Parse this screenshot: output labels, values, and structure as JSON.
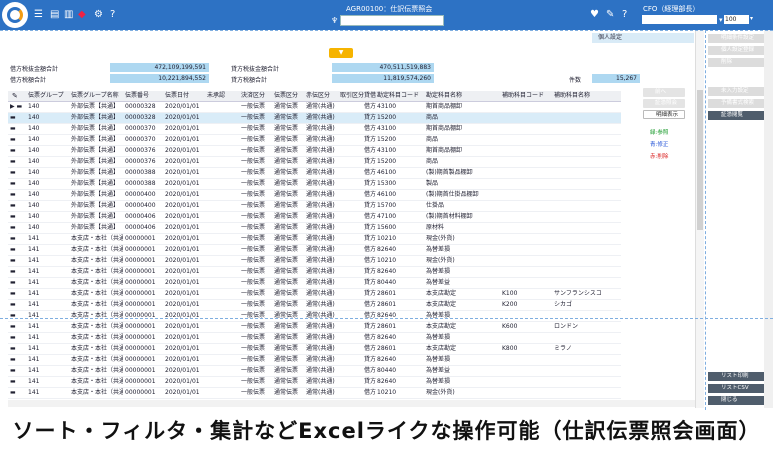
{
  "topbar": {
    "screen_title": "AGR00100：仕訳伝票照会",
    "user_name": "CFO（経理部長）",
    "zoom": "100"
  },
  "panel": {
    "personal_settings": "個人設定",
    "collapse": "▼"
  },
  "summary": {
    "debit_tax_excl_label": "借方税抜金額合計",
    "debit_tax_excl": "472,109,199,591",
    "credit_tax_excl_label": "貸方税抜金額合計",
    "credit_tax_excl": "470,511,519,883",
    "debit_tax_label": "借方税額合計",
    "debit_tax": "10,221,894,552",
    "credit_tax_label": "貸方税額合計",
    "credit_tax": "11,819,574,260",
    "count_label": "件数",
    "count": "15,267"
  },
  "grid": {
    "columns": [
      "伝票グループ",
      "伝票グループ名称",
      "伝票番号",
      "伝票日付",
      "未承認",
      "決済区分",
      "伝票区分",
      "赤伝区分",
      "取引区分",
      "貸借",
      "勘定科目コード",
      "勘定科目名称",
      "補助科目コード",
      "補助科目名称"
    ],
    "rows": [
      [
        "140",
        "外部伝票【共通】",
        "00000328",
        "2020/01/01",
        "",
        "一般伝票",
        "通常伝票",
        "通常(共通)",
        "",
        "借方",
        "43100",
        "期首商品棚卸",
        "",
        ""
      ],
      [
        "140",
        "外部伝票【共通】",
        "00000328",
        "2020/01/01",
        "",
        "一般伝票",
        "通常伝票",
        "通常(共通)",
        "",
        "貸方",
        "15200",
        "商品",
        "",
        ""
      ],
      [
        "140",
        "外部伝票【共通】",
        "00000370",
        "2020/01/01",
        "",
        "一般伝票",
        "通常伝票",
        "通常(共通)",
        "",
        "借方",
        "43100",
        "期首商品棚卸",
        "",
        ""
      ],
      [
        "140",
        "外部伝票【共通】",
        "00000370",
        "2020/01/01",
        "",
        "一般伝票",
        "通常伝票",
        "通常(共通)",
        "",
        "貸方",
        "15200",
        "商品",
        "",
        ""
      ],
      [
        "140",
        "外部伝票【共通】",
        "00000376",
        "2020/01/01",
        "",
        "一般伝票",
        "通常伝票",
        "通常(共通)",
        "",
        "借方",
        "43100",
        "期首商品棚卸",
        "",
        ""
      ],
      [
        "140",
        "外部伝票【共通】",
        "00000376",
        "2020/01/01",
        "",
        "一般伝票",
        "通常伝票",
        "通常(共通)",
        "",
        "貸方",
        "15200",
        "商品",
        "",
        ""
      ],
      [
        "140",
        "外部伝票【共通】",
        "00000388",
        "2020/01/01",
        "",
        "一般伝票",
        "通常伝票",
        "通常(共通)",
        "",
        "借方",
        "46100",
        "(製)期首製品棚卸",
        "",
        ""
      ],
      [
        "140",
        "外部伝票【共通】",
        "00000388",
        "2020/01/01",
        "",
        "一般伝票",
        "通常伝票",
        "通常(共通)",
        "",
        "貸方",
        "15300",
        "製品",
        "",
        ""
      ],
      [
        "140",
        "外部伝票【共通】",
        "00000400",
        "2020/01/01",
        "",
        "一般伝票",
        "通常伝票",
        "通常(共通)",
        "",
        "借方",
        "46100",
        "(製)期首仕掛品棚卸",
        "",
        ""
      ],
      [
        "140",
        "外部伝票【共通】",
        "00000400",
        "2020/01/01",
        "",
        "一般伝票",
        "通常伝票",
        "通常(共通)",
        "",
        "貸方",
        "15700",
        "仕掛品",
        "",
        ""
      ],
      [
        "140",
        "外部伝票【共通】",
        "00000406",
        "2020/01/01",
        "",
        "一般伝票",
        "通常伝票",
        "通常(共通)",
        "",
        "借方",
        "47100",
        "(製)期首材料棚卸",
        "",
        ""
      ],
      [
        "140",
        "外部伝票【共通】",
        "00000406",
        "2020/01/01",
        "",
        "一般伝票",
        "通常伝票",
        "通常(共通)",
        "",
        "貸方",
        "15600",
        "原材料",
        "",
        ""
      ],
      [
        "141",
        "本支店・本社（共通）",
        "00000001",
        "2020/01/01",
        "",
        "一般伝票",
        "通常伝票",
        "通常(共通)",
        "",
        "貸方",
        "10210",
        "現金(外貨)",
        "",
        ""
      ],
      [
        "141",
        "本支店・本社（共通）",
        "00000001",
        "2020/01/01",
        "",
        "一般伝票",
        "通常伝票",
        "通常(共通)",
        "",
        "借方",
        "82640",
        "為替差損",
        "",
        ""
      ],
      [
        "141",
        "本支店・本社（共通）",
        "00000001",
        "2020/01/01",
        "",
        "一般伝票",
        "通常伝票",
        "通常(共通)",
        "",
        "借方",
        "10210",
        "現金(外貨)",
        "",
        ""
      ],
      [
        "141",
        "本支店・本社（共通）",
        "00000001",
        "2020/01/01",
        "",
        "一般伝票",
        "通常伝票",
        "通常(共通)",
        "",
        "貸方",
        "82640",
        "為替差損",
        "",
        ""
      ],
      [
        "141",
        "本支店・本社（共通）",
        "00000001",
        "2020/01/01",
        "",
        "一般伝票",
        "通常伝票",
        "通常(共通)",
        "",
        "貸方",
        "80440",
        "為替差益",
        "",
        ""
      ],
      [
        "141",
        "本支店・本社（共通）",
        "00000001",
        "2020/01/01",
        "",
        "一般伝票",
        "通常伝票",
        "通常(共通)",
        "",
        "貸方",
        "28601",
        "本支店勘定",
        "K100",
        "サンフランシスコ"
      ],
      [
        "141",
        "本支店・本社（共通）",
        "00000001",
        "2020/01/01",
        "",
        "一般伝票",
        "通常伝票",
        "通常(共通)",
        "",
        "借方",
        "28601",
        "本支店勘定",
        "K200",
        "シカゴ"
      ],
      [
        "141",
        "本支店・本社（共通）",
        "00000001",
        "2020/01/01",
        "",
        "一般伝票",
        "通常伝票",
        "通常(共通)",
        "",
        "借方",
        "82640",
        "為替差損",
        "",
        ""
      ],
      [
        "141",
        "本支店・本社（共通）",
        "00000001",
        "2020/01/01",
        "",
        "一般伝票",
        "通常伝票",
        "通常(共通)",
        "",
        "貸方",
        "28601",
        "本支店勘定",
        "K600",
        "ロンドン"
      ],
      [
        "141",
        "本支店・本社（共通）",
        "00000001",
        "2020/01/01",
        "",
        "一般伝票",
        "通常伝票",
        "通常(共通)",
        "",
        "借方",
        "82640",
        "為替差損",
        "",
        ""
      ],
      [
        "141",
        "本支店・本社（共通）",
        "00000001",
        "2020/01/01",
        "",
        "一般伝票",
        "通常伝票",
        "通常(共通)",
        "",
        "借方",
        "28601",
        "本支店勘定",
        "K800",
        "ミラノ"
      ],
      [
        "141",
        "本支店・本社（共通）",
        "00000001",
        "2020/01/01",
        "",
        "一般伝票",
        "通常伝票",
        "通常(共通)",
        "",
        "貸方",
        "82640",
        "為替差損",
        "",
        ""
      ],
      [
        "141",
        "本支店・本社（共通）",
        "00000001",
        "2020/01/01",
        "",
        "一般伝票",
        "通常伝票",
        "通常(共通)",
        "",
        "借方",
        "80440",
        "為替差益",
        "",
        ""
      ],
      [
        "141",
        "本支店・本社（共通）",
        "00000001",
        "2020/01/01",
        "",
        "一般伝票",
        "通常伝票",
        "通常(共通)",
        "",
        "貸方",
        "82640",
        "為替差損",
        "",
        ""
      ],
      [
        "141",
        "本支店・本社（共通）",
        "00000001",
        "2020/01/01",
        "",
        "一般伝票",
        "通常伝票",
        "通常(共通)",
        "",
        "借方",
        "10210",
        "現金(外貨)",
        "",
        ""
      ]
    ]
  },
  "side": {
    "prev": "前へ",
    "history": "証憑照会",
    "journal_display": "明細表示",
    "legend_green": "緑:参照",
    "legend_blue": "青:修正",
    "legend_red": "赤:削除"
  },
  "right_panel": {
    "btn1": "明細条件設定",
    "btn2": "個人設定登録",
    "btn3": "削除",
    "btn4": "未入力設定",
    "btn5": "予備書式検索",
    "btn6": "証憑閲覧",
    "print": "リスト印刷",
    "csv": "リストCSV",
    "close": "閉じる"
  },
  "caption": "ソート・フィルタ・集計などExcelライクな操作可能（仕訳伝票照会画面）",
  "colors": {
    "topbar": "#2d72c4",
    "accent": "#f6b400",
    "summary_fill": "#aed8f1"
  }
}
